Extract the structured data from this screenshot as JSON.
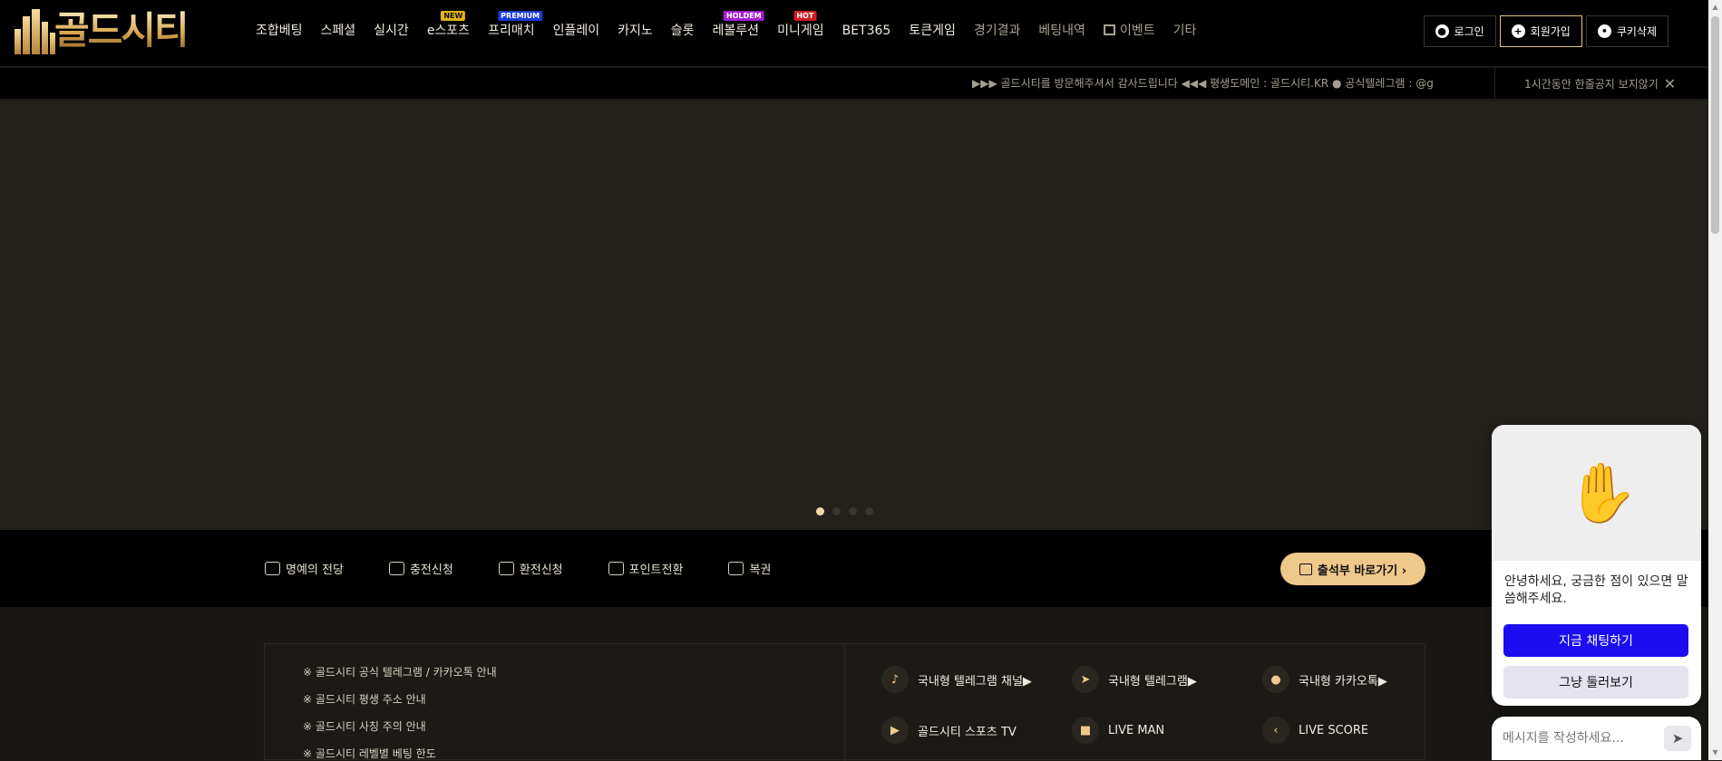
{
  "brand": {
    "logo_text": "골드시티"
  },
  "nav": {
    "items": [
      {
        "label": "조합베팅",
        "badge": ""
      },
      {
        "label": "스페셜",
        "badge": ""
      },
      {
        "label": "실시간",
        "badge": ""
      },
      {
        "label": "e스포츠",
        "badge": "NEW"
      },
      {
        "label": "프리매치",
        "badge": "PREMIUM"
      },
      {
        "label": "인플레이",
        "badge": ""
      },
      {
        "label": "카지노",
        "badge": ""
      },
      {
        "label": "슬롯",
        "badge": ""
      },
      {
        "label": "레볼루션",
        "badge": "HOLDEM"
      },
      {
        "label": "미니게임",
        "badge": "HOT"
      },
      {
        "label": "BET365",
        "badge": ""
      },
      {
        "label": "토큰게임",
        "badge": ""
      },
      {
        "label": "경기결과",
        "badge": ""
      },
      {
        "label": "베팅내역",
        "badge": ""
      },
      {
        "label": "이벤트",
        "badge": ""
      },
      {
        "label": "기타",
        "badge": ""
      }
    ]
  },
  "header_buttons": {
    "login": "로그인",
    "signup": "회원가입",
    "cookie": "쿠키삭제"
  },
  "ticker": {
    "text": "▶▶▶ 골드시티를 방문해주셔서 감사드립니다 ◀◀◀ 평생도메인 : 골드시티.KR ● 공식텔레그램 : @g",
    "hide_label": "1시간동안 한줄공지 보지않기"
  },
  "banner": {
    "slides": 4,
    "active": 1
  },
  "quickbar": {
    "items": [
      "명예의 전당",
      "충전신청",
      "환전신청",
      "포인트전환",
      "복권"
    ],
    "attendance": "출석부 바로가기 ›"
  },
  "notices": [
    "※ 골드시티 공식 텔레그램 / 카카오톡 안내",
    "※ 골드시티 평생 주소 안내",
    "※ 골드시티 사칭 주의 안내",
    "※ 골드시티 레벨별 베팅 한도"
  ],
  "links": [
    {
      "label": "국내형 텔레그램 채널▶",
      "icon": "bell-icon",
      "glyph": "♪"
    },
    {
      "label": "국내형 텔레그램▶",
      "icon": "telegram-icon",
      "glyph": "➤"
    },
    {
      "label": "국내형 카카오톡▶",
      "icon": "talk-icon",
      "glyph": "●"
    },
    {
      "label": "골드시티 스포츠 TV",
      "icon": "video-icon",
      "glyph": "▶"
    },
    {
      "label": "LIVE MAN",
      "icon": "live-icon",
      "glyph": "■"
    },
    {
      "label": "LIVE SCORE",
      "icon": "score-icon",
      "glyph": "‹"
    }
  ],
  "chat": {
    "greeting": "안녕하세요, 궁금한 점이 있으면 말씀해주세요.",
    "chat_now": "지금 채팅하기",
    "just_browse": "그냥 둘러보기",
    "placeholder": "메시지를 작성하세요..."
  },
  "colors": {
    "accent": "#efc88b",
    "chat_primary": "#1a0ef0",
    "header_bg": "#000000"
  }
}
